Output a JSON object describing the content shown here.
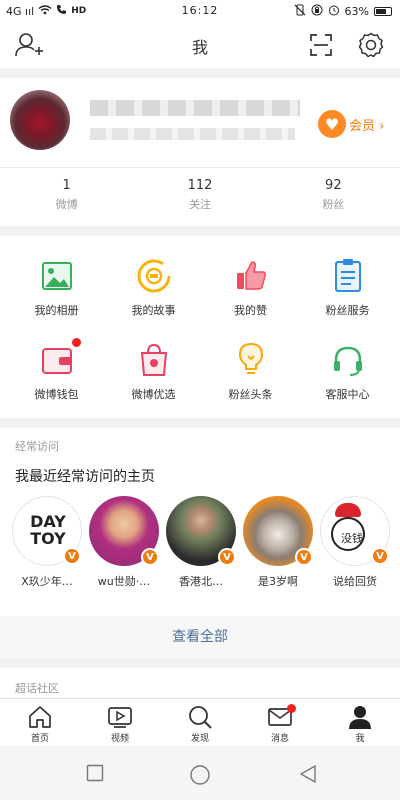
{
  "status": {
    "network": "4G ııl",
    "hd": "HD",
    "time": "16:12",
    "battery": "63%"
  },
  "nav": {
    "title": "我"
  },
  "profile": {
    "vip_label": "会员 ›"
  },
  "stats": [
    {
      "num": "1",
      "label": "微博"
    },
    {
      "num": "112",
      "label": "关注"
    },
    {
      "num": "92",
      "label": "粉丝"
    }
  ],
  "grid": [
    {
      "label": "我的相册",
      "icon": "photo-album-icon",
      "color": "#38b05a"
    },
    {
      "label": "我的故事",
      "icon": "story-icon",
      "color": "#f5b50f"
    },
    {
      "label": "我的赞",
      "icon": "thumbs-up-icon",
      "color": "#f04a5a"
    },
    {
      "label": "粉丝服务",
      "icon": "clipboard-icon",
      "color": "#2d8be0"
    },
    {
      "label": "微博钱包",
      "icon": "wallet-icon",
      "color": "#e84060"
    },
    {
      "label": "微博优选",
      "icon": "shopping-bag-icon",
      "color": "#e84060"
    },
    {
      "label": "粉丝头条",
      "icon": "lightbulb-icon",
      "color": "#f5a80f"
    },
    {
      "label": "客服中心",
      "icon": "headset-icon",
      "color": "#3cb06a"
    }
  ],
  "visits": {
    "section_title": "经常访问",
    "subtitle": "我最近经常访问的主页",
    "items": [
      {
        "name": "X玖少年…",
        "badge": "V",
        "logo": [
          "DAY",
          "TOY"
        ]
      },
      {
        "name": "wu世勋·…",
        "badge": "V"
      },
      {
        "name": "香港北…",
        "badge": "V"
      },
      {
        "name": "是3岁啊",
        "badge": "V"
      },
      {
        "name": "说给回货",
        "badge": "V",
        "logo_text": "没钱"
      }
    ],
    "view_all": "查看全部"
  },
  "community": {
    "title": "超话社区"
  },
  "tabs": [
    {
      "label": "首页",
      "icon": "home-icon"
    },
    {
      "label": "视频",
      "icon": "video-icon"
    },
    {
      "label": "发现",
      "icon": "discover-icon"
    },
    {
      "label": "消息",
      "icon": "message-icon",
      "dot": true
    },
    {
      "label": "我",
      "icon": "profile-icon",
      "active": true
    }
  ]
}
